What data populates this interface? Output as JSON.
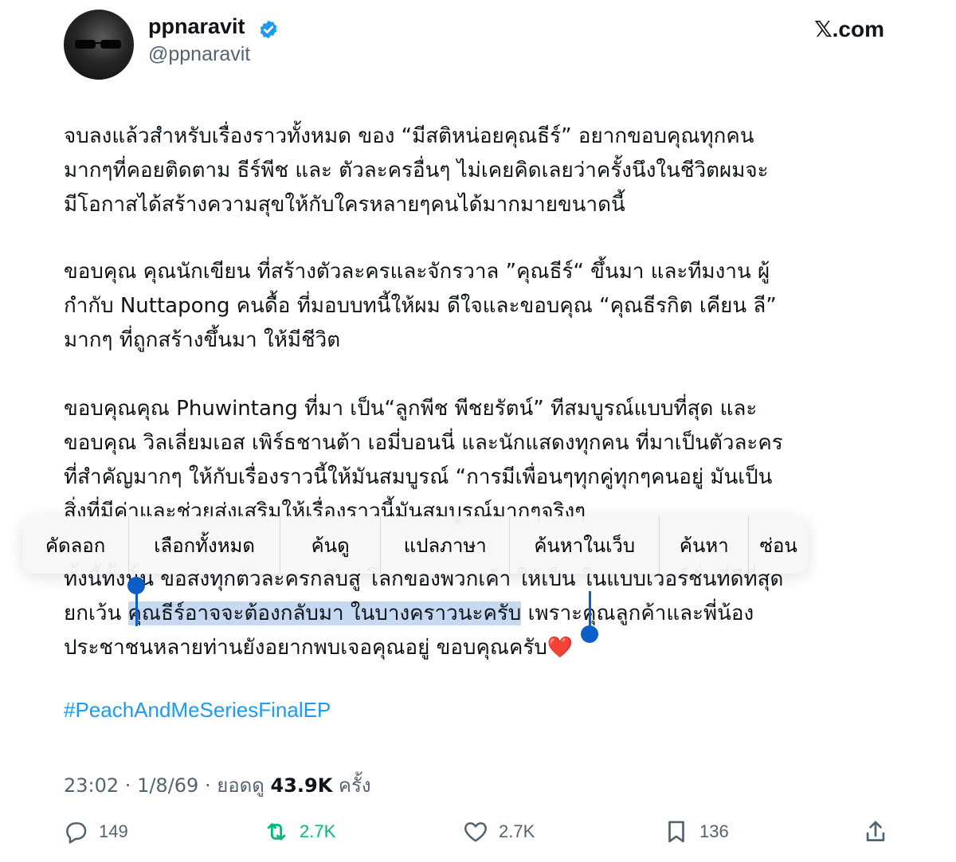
{
  "author": {
    "display_name": "ppnaravit",
    "handle": "@ppnaravit",
    "verified_icon": "verified-badge-icon"
  },
  "site": "𝕏.com",
  "paragraphs": {
    "p1": [
      "จบลงแล้วสำหรับเรื่องราวทั้งหมด ของ “มีสติหน่อยคุณธีร์” อยากขอบคุณทุกคน",
      "มากๆที่คอยติดตาม ธีร์พีช และ ตัวละครอื่นๆ ไม่เคยคิดเลยว่าครั้งนึงในชีวิตผมจะ",
      "มีโอกาสได้สร้างความสุขให้กับใครหลายๆคนได้มากมายขนาดนี้"
    ],
    "p2": [
      "ขอบคุณ คุณนักเขียน ที่สร้างตัวละครและจักรวาล ”คุณธีร์“ ขึ้นมา และทีมงาน ผู้",
      "กำกับ Nuttapong คนดื้อ ที่มอบบทนี้ให้ผม ดีใจและขอบคุณ “คุณธีรกิต เคียน ลี”",
      "มากๆ ที่ถูกสร้างขึ้นมา ให้มีชีวิต"
    ],
    "p3": [
      "ขอบคุณคุณ Phuwintang ที่มา เป็น“ลูกพีช พีชยรัตน์” ทีสมบูรณ์แบบที่สุด และ",
      "ขอบคุณ วิลเลี่ยมเอส เพิร์ธชานต้า เอมี่บอนนี่ และนักแสดงทุกคน ที่มาเป็นตัวละคร",
      "ที่สำคัญมากๆ ให้กับเรื่องราวนี้ให้มันสมบูรณ์ “การมีเพื่อนๆทุกคู่ทุกๆคนอยู่ มันเป็น",
      "สิ่งที่มีค่าและช่วยส่งเสริมให้เรื่องราวนี้มันสมบูรณ์มากๆจริงๆ"
    ],
    "p4_line1": "ทั้งนี้ทั้งนั้น ขอส่งทุกตัวละครกลับสู่ โลกของพวกเค้า ให้เป็น ในแบบเวอร์ชั่นที่ดีที่สุด",
    "p4_line2_before": "ยกเว้น ",
    "p4_line2_selected": "คุณธีร์อาจจะต้องกลับมา ในบางคราวนะครับ",
    "p4_line2_after": " เพราะคุณลูกค้าและพี่น้อง",
    "p4_line3": "ประชาชนหลายท่านยังอยากพบเจอคุณอยู่ ขอบคุณครับ❤️"
  },
  "hashtag": "#PeachAndMeSeriesFinalEP",
  "meta": {
    "time": "23:02",
    "sep1": " · ",
    "date": "1/8/69",
    "sep2": " · ยอดดู ",
    "views": "43.9K",
    "views_suffix": " ครั้ง"
  },
  "actions": {
    "replies": "149",
    "reposts": "2.7K",
    "likes": "2.7K",
    "bookmarks": "136"
  },
  "context_menu": {
    "items": [
      "คัดลอก",
      "เลือกทั้งหมด",
      "ค้นดู",
      "แปลภาษา",
      "ค้นหาในเว็บ",
      "ค้นหา",
      "ซ่อน"
    ]
  },
  "colors": {
    "accent": "#1d9bf0",
    "repost_active": "#00ba7c",
    "selection": "#c7d9f1",
    "selection_handle": "#0a60c8"
  }
}
